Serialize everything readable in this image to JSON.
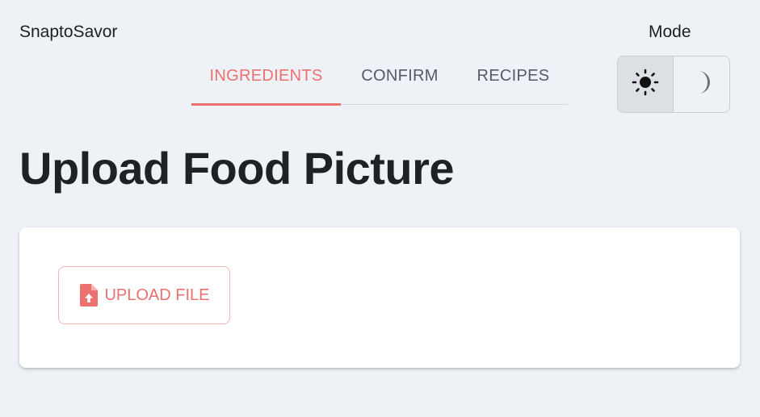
{
  "header": {
    "brand": "SnaptoSavor",
    "mode_label": "Mode"
  },
  "tabs": [
    {
      "label": "INGREDIENTS",
      "active": true
    },
    {
      "label": "CONFIRM",
      "active": false
    },
    {
      "label": "RECIPES",
      "active": false
    }
  ],
  "mode_toggle": {
    "options": [
      {
        "icon": "sun-icon",
        "selected": true
      },
      {
        "icon": "moon-icon",
        "selected": false
      }
    ]
  },
  "main": {
    "title": "Upload Food Picture",
    "upload_button": {
      "label": "UPLOAD FILE",
      "icon": "file-upload-icon"
    }
  },
  "colors": {
    "accent": "#ec7070",
    "background": "#eef2f6",
    "card": "#ffffff",
    "text": "#1f1f1f"
  }
}
